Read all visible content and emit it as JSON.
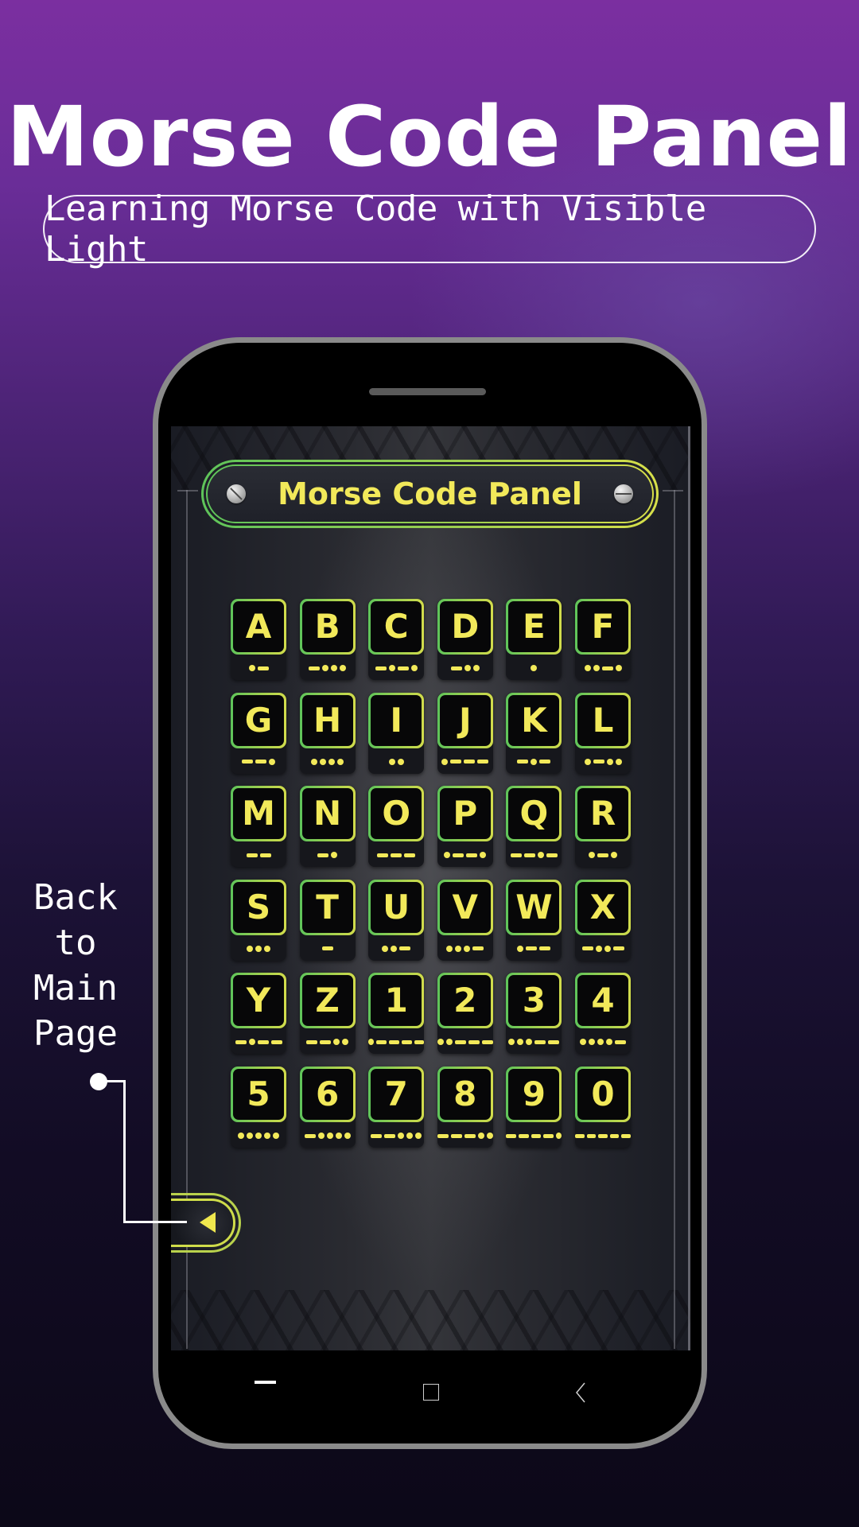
{
  "hero": {
    "title": "Morse Code Panel",
    "subtitle": "Learning Morse Code with Visible Light"
  },
  "app": {
    "header_title": "Morse Code Panel",
    "keys": [
      {
        "char": "A",
        "morse": ".-"
      },
      {
        "char": "B",
        "morse": "-..."
      },
      {
        "char": "C",
        "morse": "-.-."
      },
      {
        "char": "D",
        "morse": "-.."
      },
      {
        "char": "E",
        "morse": "."
      },
      {
        "char": "F",
        "morse": "..-."
      },
      {
        "char": "G",
        "morse": "--."
      },
      {
        "char": "H",
        "morse": "...."
      },
      {
        "char": "I",
        "morse": ".."
      },
      {
        "char": "J",
        "morse": ".---"
      },
      {
        "char": "K",
        "morse": "-.-"
      },
      {
        "char": "L",
        "morse": ".-.."
      },
      {
        "char": "M",
        "morse": "--"
      },
      {
        "char": "N",
        "morse": "-."
      },
      {
        "char": "O",
        "morse": "---"
      },
      {
        "char": "P",
        "morse": ".--."
      },
      {
        "char": "Q",
        "morse": "--.-"
      },
      {
        "char": "R",
        "morse": ".-."
      },
      {
        "char": "S",
        "morse": "..."
      },
      {
        "char": "T",
        "morse": "-"
      },
      {
        "char": "U",
        "morse": "..-"
      },
      {
        "char": "V",
        "morse": "...-"
      },
      {
        "char": "W",
        "morse": ".--"
      },
      {
        "char": "X",
        "morse": "-..-"
      },
      {
        "char": "Y",
        "morse": "-.--"
      },
      {
        "char": "Z",
        "morse": "--.."
      },
      {
        "char": "1",
        "morse": ".----"
      },
      {
        "char": "2",
        "morse": "..---"
      },
      {
        "char": "3",
        "morse": "...--"
      },
      {
        "char": "4",
        "morse": "....-"
      },
      {
        "char": "5",
        "morse": "....."
      },
      {
        "char": "6",
        "morse": "-...."
      },
      {
        "char": "7",
        "morse": "--..."
      },
      {
        "char": "8",
        "morse": "---.."
      },
      {
        "char": "9",
        "morse": "----."
      },
      {
        "char": "0",
        "morse": "-----"
      }
    ],
    "back_button_icon": "triangle-left-icon"
  },
  "annotation": {
    "lines": [
      "Back",
      "to",
      "Main",
      "Page"
    ]
  },
  "navbar": {
    "recent_icon": "recent-apps-icon",
    "home_icon": "home-square-icon",
    "back_icon": "back-chevron-icon"
  },
  "colors": {
    "accent_yellow": "#f2e95a",
    "border_green": "#5ec45a",
    "border_yellow": "#d2dc4c",
    "phone_frame": "#8a8a8a"
  }
}
